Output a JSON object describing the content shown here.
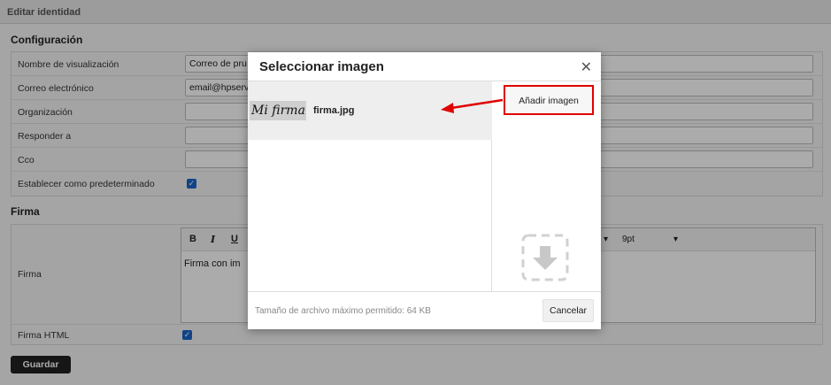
{
  "page": {
    "header_title": "Editar identidad",
    "config_title": "Configuración",
    "rows": [
      {
        "label": "Nombre de visualización",
        "value": "Correo de pru"
      },
      {
        "label": "Correo electrónico",
        "value": "email@hpserv"
      },
      {
        "label": "Organización",
        "value": ""
      },
      {
        "label": "Responder a",
        "value": ""
      },
      {
        "label": "Cco",
        "value": ""
      },
      {
        "label": "Establecer como predeterminado",
        "checked": true
      }
    ],
    "signature_title": "Firma",
    "signature_label": "Firma",
    "signature_text": "Firma con im",
    "html_signature_label": "Firma HTML",
    "font_size": "9pt",
    "save_label": "Guardar",
    "toolbar": {
      "bold": "B",
      "italic": "I",
      "underline": "U"
    }
  },
  "dialog": {
    "title": "Seleccionar imagen",
    "close_glyph": "✕",
    "add_image_label": "Añadir imagen",
    "files": [
      {
        "thumb_text": "Mi firma",
        "name": "firma.jpg"
      }
    ],
    "footer_text": "Tamaño de archivo máximo permitido: 64 KB",
    "cancel_label": "Cancelar"
  },
  "colors": {
    "annotation_red": "#e00000",
    "checkbox_blue": "#1a66c9",
    "overlay": "rgba(0,0,0,0.33)"
  }
}
